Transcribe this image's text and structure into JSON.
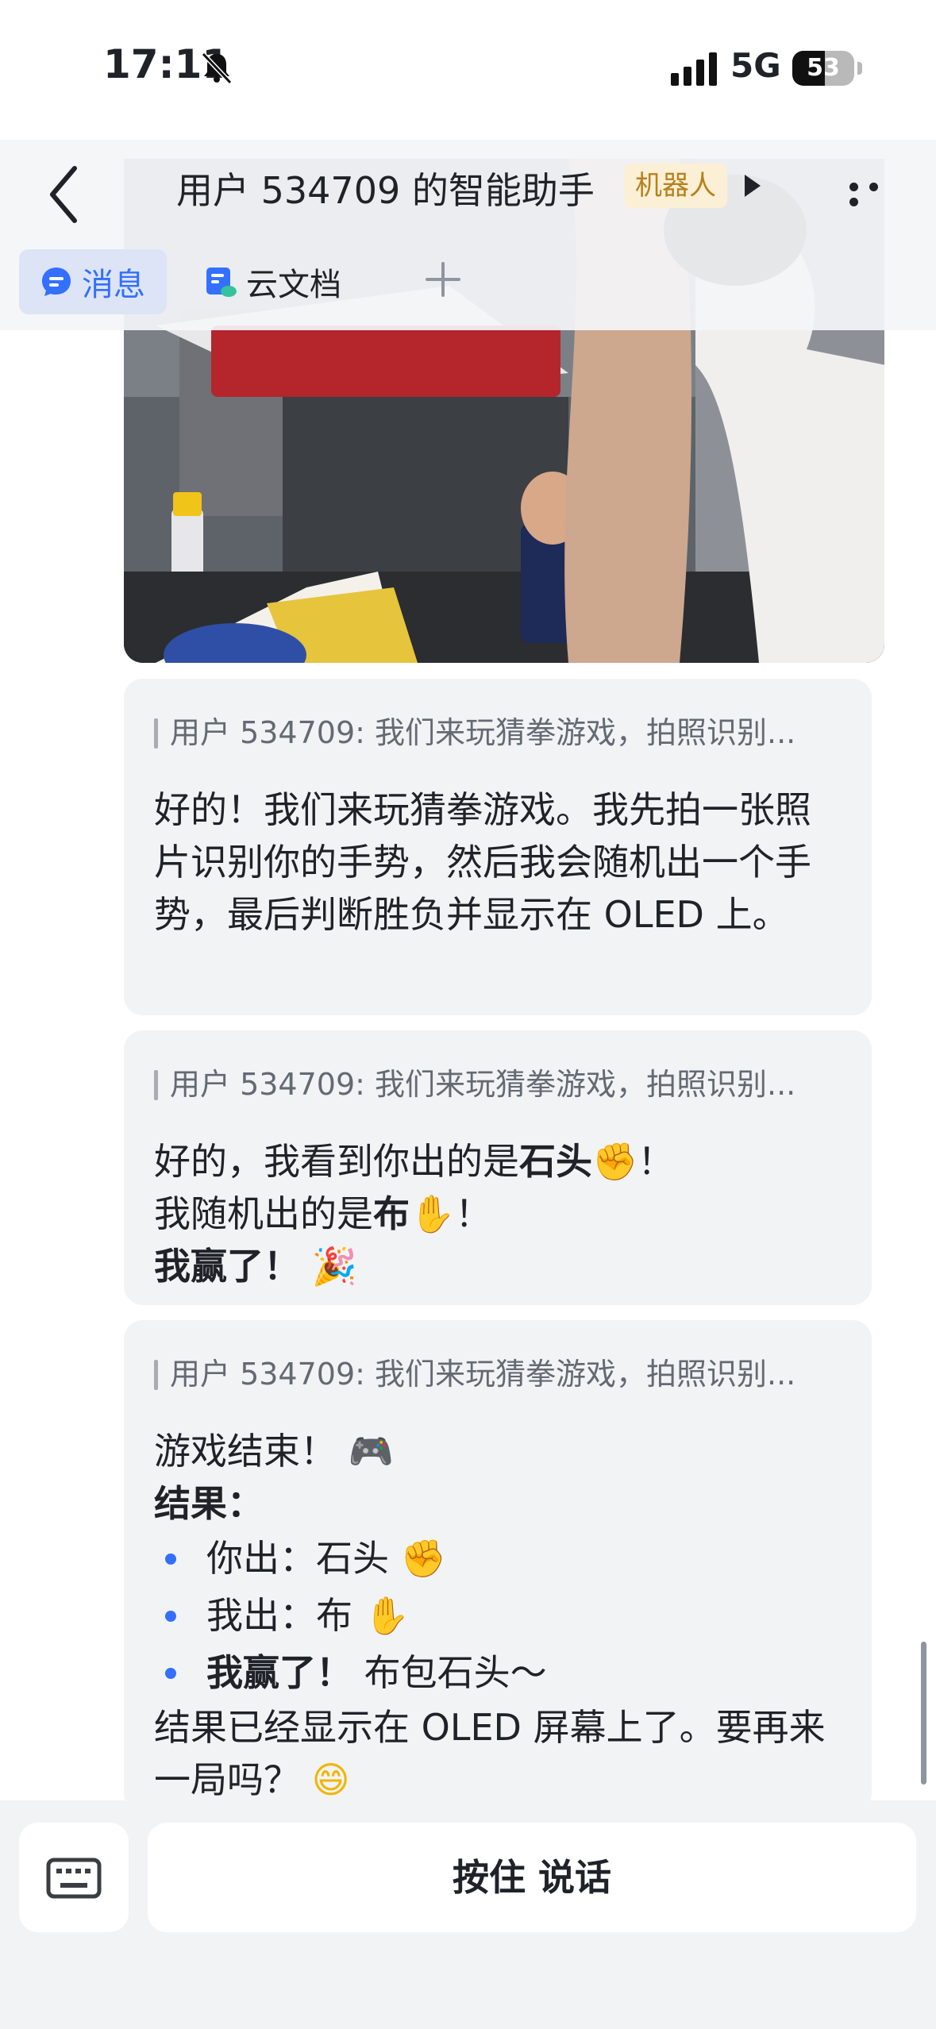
{
  "status_bar": {
    "time": "17:11",
    "network": "5G",
    "battery": "53",
    "battery_level": 0.53
  },
  "header": {
    "title": "用户 534709 的智能助手",
    "badge": "机器人",
    "tabs": [
      {
        "label": "消息",
        "active": true
      },
      {
        "label": "云文档",
        "active": false
      }
    ]
  },
  "messages": [
    {
      "quote": "用户 534709: 我们来玩猜拳游戏，拍照识别...",
      "text": "好的！我们来玩猜拳游戏。我先拍一张照片识别你的手势，然后我会随机出一个手势，最后判断胜负并显示在 OLED 上。"
    },
    {
      "quote": "用户 534709: 我们来玩猜拳游戏，拍照识别...",
      "line1_prefix": "好的，我看到你出的是",
      "line1_bold": "石头",
      "line1_emoji": "✊",
      "line1_suffix": "！",
      "line2_prefix": "我随机出的是",
      "line2_bold": "布",
      "line2_emoji": "✋",
      "line2_suffix": "！",
      "line3_bold": "我赢了！",
      "line3_emoji": "🎉"
    },
    {
      "quote": "用户 534709: 我们来玩猜拳游戏，拍照识别...",
      "line1": "游戏结束！",
      "line1_emoji": "🎮",
      "result_label": "结果：",
      "you_played": "你出：石头",
      "you_emoji": "✊",
      "i_played": "我出：布",
      "i_emoji": "✋",
      "winner_bold": "我赢了！",
      "winner_note": "布包石头～",
      "closing": "结果已经显示在 OLED 屏幕上了。要再来一局吗？",
      "closing_emoji": "😄"
    }
  ],
  "input_bar": {
    "hold_to_talk": "按住 说话"
  }
}
